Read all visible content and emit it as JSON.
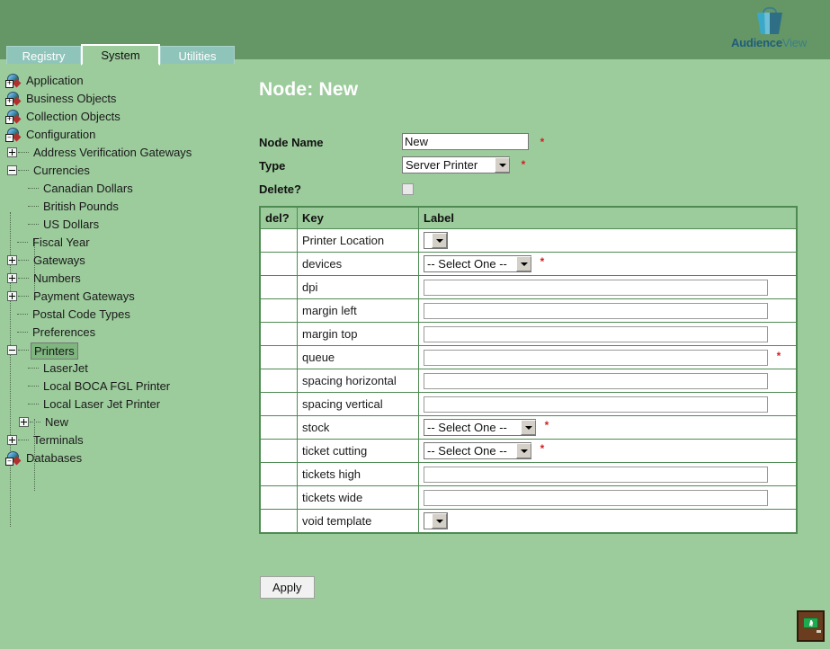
{
  "app": {
    "logo_part1": "Audience",
    "logo_part2": "View",
    "logo_icon": "shopping-bag-icon"
  },
  "tabs": [
    {
      "label": "Registry",
      "active": false
    },
    {
      "label": "System",
      "active": true
    },
    {
      "label": "Utilities",
      "active": false
    }
  ],
  "tree": [
    {
      "label": "Application",
      "depth": 0,
      "icon": "globe-plus-icon",
      "selected": false
    },
    {
      "label": "Business Objects",
      "depth": 0,
      "icon": "globe-plus-icon",
      "selected": false
    },
    {
      "label": "Collection Objects",
      "depth": 0,
      "icon": "globe-plus-icon",
      "selected": false
    },
    {
      "label": "Configuration",
      "depth": 0,
      "icon": "globe-minus-icon",
      "selected": false
    },
    {
      "label": "Address Verification Gateways",
      "depth": 1,
      "icon": "expand-plus",
      "selected": false
    },
    {
      "label": "Currencies",
      "depth": 1,
      "icon": "expand-minus",
      "selected": false
    },
    {
      "label": "Canadian Dollars",
      "depth": 2,
      "icon": "leaf",
      "selected": false
    },
    {
      "label": "British Pounds",
      "depth": 2,
      "icon": "leaf",
      "selected": false
    },
    {
      "label": "US Dollars",
      "depth": 2,
      "icon": "leaf",
      "selected": false
    },
    {
      "label": "Fiscal Year",
      "depth": 1,
      "icon": "leaf",
      "selected": false
    },
    {
      "label": "Gateways",
      "depth": 1,
      "icon": "expand-plus",
      "selected": false
    },
    {
      "label": "Numbers",
      "depth": 1,
      "icon": "expand-plus",
      "selected": false
    },
    {
      "label": "Payment Gateways",
      "depth": 1,
      "icon": "expand-plus",
      "selected": false
    },
    {
      "label": "Postal Code Types",
      "depth": 1,
      "icon": "leaf",
      "selected": false
    },
    {
      "label": "Preferences",
      "depth": 1,
      "icon": "leaf",
      "selected": false
    },
    {
      "label": "Printers",
      "depth": 1,
      "icon": "expand-minus",
      "selected": true
    },
    {
      "label": "LaserJet",
      "depth": 2,
      "icon": "leaf",
      "selected": false
    },
    {
      "label": "Local BOCA FGL Printer",
      "depth": 2,
      "icon": "leaf",
      "selected": false
    },
    {
      "label": "Local Laser Jet Printer",
      "depth": 2,
      "icon": "leaf",
      "selected": false
    },
    {
      "label": "New",
      "depth": 2,
      "icon": "expand-plus",
      "selected": false
    },
    {
      "label": "Terminals",
      "depth": 1,
      "icon": "expand-plus",
      "selected": false
    },
    {
      "label": "Databases",
      "depth": 0,
      "icon": "globe-minus-icon",
      "selected": false
    }
  ],
  "main": {
    "title": "Node: New",
    "required_marker": "*",
    "fields": [
      {
        "label": "Node Name",
        "control": "text",
        "value": "New",
        "placeholder": "",
        "required": true
      },
      {
        "label": "Type",
        "control": "select",
        "value": "Server Printer",
        "required": true
      },
      {
        "label": "Delete?",
        "control": "checkbox",
        "value": "",
        "checked": false,
        "required": false
      }
    ],
    "table": {
      "columns": [
        "del?",
        "Key",
        "Label"
      ],
      "rows": [
        {
          "del": "",
          "key": "Printer Location",
          "control": "select-narrow",
          "value": "",
          "required": false
        },
        {
          "del": "",
          "key": "devices",
          "control": "select",
          "value": "-- Select One --",
          "required": true
        },
        {
          "del": "",
          "key": "dpi",
          "control": "text",
          "value": "",
          "required": false
        },
        {
          "del": "",
          "key": "margin left",
          "control": "text",
          "value": "",
          "required": false
        },
        {
          "del": "",
          "key": "margin top",
          "control": "text",
          "value": "",
          "required": false
        },
        {
          "del": "",
          "key": "queue",
          "control": "text",
          "value": "",
          "required": true
        },
        {
          "del": "",
          "key": "spacing horizontal",
          "control": "text",
          "value": "",
          "required": false
        },
        {
          "del": "",
          "key": "spacing vertical",
          "control": "text",
          "value": "",
          "required": false
        },
        {
          "del": "",
          "key": "stock",
          "control": "select",
          "value": "-- Select One --",
          "required": true
        },
        {
          "del": "",
          "key": "ticket cutting",
          "control": "select",
          "value": "-- Select One --",
          "required": true
        },
        {
          "del": "",
          "key": "tickets high",
          "control": "text",
          "value": "",
          "required": false
        },
        {
          "del": "",
          "key": "tickets wide",
          "control": "text",
          "value": "",
          "required": false
        },
        {
          "del": "",
          "key": "void template",
          "control": "select-narrow",
          "value": "",
          "required": false
        }
      ]
    },
    "apply_label": "Apply"
  },
  "footer": {
    "exit_icon": "exit-door-icon"
  },
  "colors": {
    "header_green": "#659766",
    "body_green": "#9ccb9c",
    "tab_inactive": "#8fc4bb",
    "table_border": "#4f8a53",
    "required_red": "#d02020",
    "selected_node": "#7fb57f"
  }
}
